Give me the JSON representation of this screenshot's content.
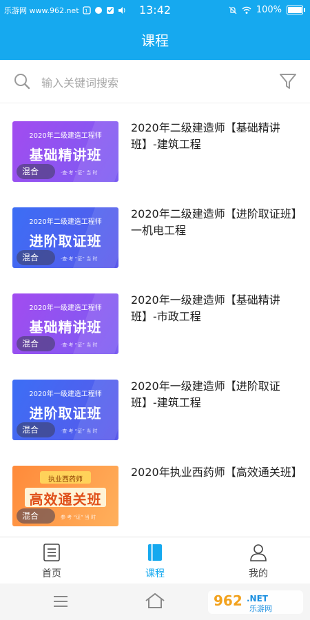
{
  "status_bar": {
    "site_label": "乐游网 www.962.net",
    "time": "13:42",
    "battery": "100%"
  },
  "header": {
    "title": "课程"
  },
  "search": {
    "placeholder": "输入关键词搜索"
  },
  "courses": [
    {
      "title": "2020年二级建造师【基础精讲班】-建筑工程",
      "thumb_top": "2020年二级建造工程师",
      "thumb_big": "基础精讲班",
      "tag": "混合",
      "thumb_deco": "·查·考 “证” 当 时",
      "color_a": "#a24cf0",
      "color_b": "#7a5cf2"
    },
    {
      "title": "2020年二级建造师【进阶取证班】一机电工程",
      "thumb_top": "2020年二级建造工程师",
      "thumb_big": "进阶取证班",
      "tag": "混合",
      "thumb_deco": "·查·考 “证” 当 时",
      "color_a": "#3c6ef5",
      "color_b": "#5a58ea"
    },
    {
      "title": "2020年一级建造师【基础精讲班】-市政工程",
      "thumb_top": "2020年一级建造工程师",
      "thumb_big": "基础精讲班",
      "tag": "混合",
      "thumb_deco": "·查·考 “证” 当 时",
      "color_a": "#a24cf0",
      "color_b": "#7a5cf2"
    },
    {
      "title": "2020年一级建造师【进阶取证班】-建筑工程",
      "thumb_top": "2020年一级建造工程师",
      "thumb_big": "进阶取证班",
      "tag": "混合",
      "thumb_deco": "·查·考 “证” 当 时",
      "color_a": "#3c6ef5",
      "color_b": "#5a58ea"
    },
    {
      "title": "2020年执业西药师【高效通关班】",
      "thumb_top": "执业西药师",
      "thumb_big": "高效通关班",
      "tag": "混合",
      "thumb_deco": "参 考 “证” 当 时",
      "color_a": "#ff8a3a",
      "color_b": "#ffb05c"
    }
  ],
  "tabs": [
    {
      "label": "首页",
      "icon": "home-list-icon",
      "active": false
    },
    {
      "label": "课程",
      "icon": "book-icon",
      "active": true
    },
    {
      "label": "我的",
      "icon": "person-icon",
      "active": false
    }
  ],
  "colors": {
    "accent": "#16a9ef",
    "tab_inactive": "#444444",
    "tab_active": "#16a9ef"
  },
  "nav_buttons": [
    "menu-icon",
    "home-outline-icon",
    "back-icon"
  ],
  "watermark": {
    "text": "962.NET",
    "sub": "乐游网"
  }
}
